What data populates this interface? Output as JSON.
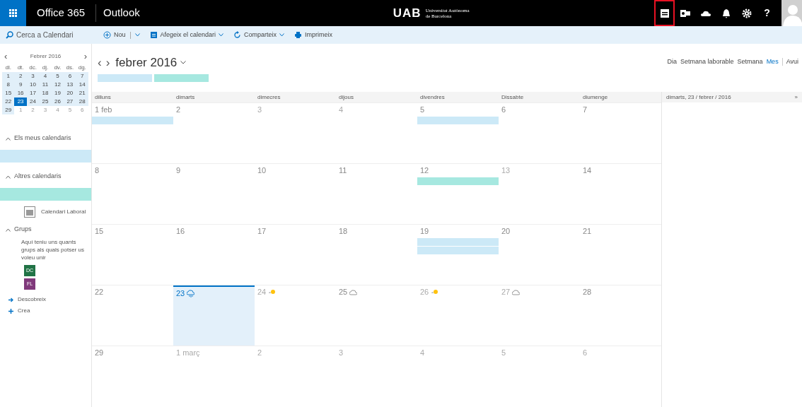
{
  "top_bar": {
    "suite": "Office 365",
    "app": "Outlook",
    "logo": "UAB",
    "logo_subtitle": [
      "Universitat Autònoma",
      "de Barcelona"
    ],
    "icons": [
      {
        "kind": "calendar",
        "selected": true
      },
      {
        "kind": "outlook",
        "selected": false
      },
      {
        "kind": "cloud",
        "selected": false
      },
      {
        "kind": "bell",
        "selected": false
      },
      {
        "kind": "gear",
        "selected": false
      },
      {
        "kind": "help",
        "label": "?",
        "selected": false
      }
    ]
  },
  "toolbar": {
    "search_placeholder": "Cerca a Calendari",
    "actions": [
      {
        "kind": "new",
        "label": "Nou",
        "split": true
      },
      {
        "kind": "add",
        "label": "Afegeix el calendari",
        "split": false
      },
      {
        "kind": "share",
        "label": "Comparteix",
        "split": false
      },
      {
        "kind": "print",
        "label": "Imprimeix"
      }
    ]
  },
  "mini_calendar": {
    "prev": "‹",
    "title": "Febrer 2016",
    "next": "›",
    "weekdays": [
      "dl.",
      "dt.",
      "dc.",
      "dj.",
      "dv.",
      "ds.",
      "dg."
    ],
    "weeks": [
      [
        {
          "d": "1",
          "muted": false,
          "selected": false
        },
        {
          "d": "2",
          "muted": false,
          "selected": false
        },
        {
          "d": "3",
          "muted": false,
          "selected": false
        },
        {
          "d": "4",
          "muted": false,
          "selected": false
        },
        {
          "d": "5",
          "muted": false,
          "selected": false
        },
        {
          "d": "6",
          "muted": false,
          "selected": false
        },
        {
          "d": "7",
          "muted": false,
          "selected": false
        }
      ],
      [
        {
          "d": "8",
          "muted": false,
          "selected": false
        },
        {
          "d": "9",
          "muted": false,
          "selected": false
        },
        {
          "d": "10",
          "muted": false,
          "selected": false
        },
        {
          "d": "11",
          "muted": false,
          "selected": false
        },
        {
          "d": "12",
          "muted": false,
          "selected": false
        },
        {
          "d": "13",
          "muted": false,
          "selected": false
        },
        {
          "d": "14",
          "muted": false,
          "selected": false
        }
      ],
      [
        {
          "d": "15",
          "muted": false,
          "selected": false
        },
        {
          "d": "16",
          "muted": false,
          "selected": false
        },
        {
          "d": "17",
          "muted": false,
          "selected": false
        },
        {
          "d": "18",
          "muted": false,
          "selected": false
        },
        {
          "d": "19",
          "muted": false,
          "selected": false
        },
        {
          "d": "20",
          "muted": false,
          "selected": false
        },
        {
          "d": "21",
          "muted": false,
          "selected": false
        }
      ],
      [
        {
          "d": "22",
          "muted": false,
          "selected": false
        },
        {
          "d": "23",
          "muted": false,
          "selected": true
        },
        {
          "d": "24",
          "muted": false,
          "selected": false
        },
        {
          "d": "25",
          "muted": false,
          "selected": false
        },
        {
          "d": "26",
          "muted": false,
          "selected": false
        },
        {
          "d": "27",
          "muted": false,
          "selected": false
        },
        {
          "d": "28",
          "muted": false,
          "selected": false
        }
      ],
      [
        {
          "d": "29",
          "muted": false,
          "selected": false
        },
        {
          "d": "1",
          "muted": true,
          "selected": false
        },
        {
          "d": "2",
          "muted": true,
          "selected": false
        },
        {
          "d": "3",
          "muted": true,
          "selected": false
        },
        {
          "d": "4",
          "muted": true,
          "selected": false
        },
        {
          "d": "5",
          "muted": true,
          "selected": false
        },
        {
          "d": "6",
          "muted": true,
          "selected": false
        }
      ]
    ]
  },
  "sidebar": {
    "sections": [
      {
        "title": "Els meus calendaris",
        "expanded": true,
        "items": [
          {
            "kind": "color_bar",
            "color": "#cce9f7"
          }
        ]
      },
      {
        "title": "Altres calendaris",
        "expanded": true,
        "items": [
          {
            "kind": "color_bar",
            "color": "#a6e8e0"
          },
          {
            "kind": "calendar",
            "label": "Calendari Laboral"
          }
        ]
      },
      {
        "title": "Grups",
        "expanded": true,
        "items": [
          {
            "kind": "note",
            "label": "Aquí teniu uns quants grups als quals potser us voleu unir"
          },
          {
            "kind": "group",
            "label": "DC",
            "color": "#217346"
          },
          {
            "kind": "group",
            "label": "FL",
            "color": "#80397b"
          }
        ]
      }
    ],
    "links": [
      {
        "kind": "arrow",
        "label": "Descobreix"
      },
      {
        "kind": "plus",
        "label": "Crea"
      }
    ]
  },
  "calendar": {
    "prev": "‹",
    "next": "›",
    "title": "febrer 2016",
    "legend": [
      {
        "color": "#cce9f7"
      },
      {
        "color": "#a6e8e0"
      }
    ],
    "views": [
      {
        "label": "Dia",
        "selected": false
      },
      {
        "label": "Setmana laborable",
        "selected": false
      },
      {
        "label": "Setmana",
        "selected": false
      },
      {
        "label": "Mes",
        "selected": true
      }
    ],
    "today_button": "Avui",
    "weekdays": [
      "dilluns",
      "dimarts",
      "dimecres",
      "dijous",
      "divendres",
      "Dissabte",
      "diumenge"
    ],
    "weeks": [
      [
        {
          "label": "1 feb",
          "muted": false,
          "today": false,
          "events": [
            {
              "color": "#cce9f7"
            }
          ]
        },
        {
          "label": "2",
          "muted": false,
          "today": false
        },
        {
          "label": "3",
          "muted": true,
          "today": false
        },
        {
          "label": "4",
          "muted": true,
          "today": false
        },
        {
          "label": "5",
          "muted": false,
          "today": false,
          "events": [
            {
              "color": "#cce9f7"
            }
          ]
        },
        {
          "label": "6",
          "muted": false,
          "today": false
        },
        {
          "label": "7",
          "muted": false,
          "today": false
        }
      ],
      [
        {
          "label": "8",
          "muted": false,
          "today": false
        },
        {
          "label": "9",
          "muted": false,
          "today": false
        },
        {
          "label": "10",
          "muted": false,
          "today": false
        },
        {
          "label": "11",
          "muted": false,
          "today": false
        },
        {
          "label": "12",
          "muted": false,
          "today": false,
          "events": [
            {
              "color": "#a6e8e0"
            }
          ]
        },
        {
          "label": "13",
          "muted": true,
          "today": false
        },
        {
          "label": "14",
          "muted": false,
          "today": false
        }
      ],
      [
        {
          "label": "15",
          "muted": false,
          "today": false
        },
        {
          "label": "16",
          "muted": false,
          "today": false
        },
        {
          "label": "17",
          "muted": false,
          "today": false
        },
        {
          "label": "18",
          "muted": false,
          "today": false
        },
        {
          "label": "19",
          "muted": false,
          "today": false,
          "events": [
            {
              "color": "#cce9f7"
            },
            {
              "color": "#cce9f7"
            }
          ]
        },
        {
          "label": "20",
          "muted": false,
          "today": false
        },
        {
          "label": "21",
          "muted": false,
          "today": false
        }
      ],
      [
        {
          "label": "22",
          "muted": false,
          "today": false
        },
        {
          "label": "23",
          "muted": false,
          "today": true,
          "weather": {
            "kind": "rain"
          }
        },
        {
          "label": "24",
          "muted": true,
          "today": false,
          "weather": {
            "kind": "sun"
          }
        },
        {
          "label": "25",
          "muted": false,
          "today": false,
          "weather": {
            "kind": "cloud"
          }
        },
        {
          "label": "26",
          "muted": true,
          "today": false,
          "weather": {
            "kind": "sun"
          }
        },
        {
          "label": "27",
          "muted": true,
          "today": false,
          "weather": {
            "kind": "cloud"
          }
        },
        {
          "label": "28",
          "muted": false,
          "today": false
        }
      ],
      [
        {
          "label": "29",
          "muted": false,
          "today": false
        },
        {
          "label": "1 març",
          "muted": true,
          "today": false
        },
        {
          "label": "2",
          "muted": true,
          "today": false
        },
        {
          "label": "3",
          "muted": true,
          "today": false
        },
        {
          "label": "4",
          "muted": true,
          "today": false
        },
        {
          "label": "5",
          "muted": true,
          "today": false
        },
        {
          "label": "6",
          "muted": true,
          "today": false
        }
      ]
    ]
  },
  "day_pane": {
    "title": "dimarts, 23 / febrer / 2016",
    "expand": "»"
  }
}
